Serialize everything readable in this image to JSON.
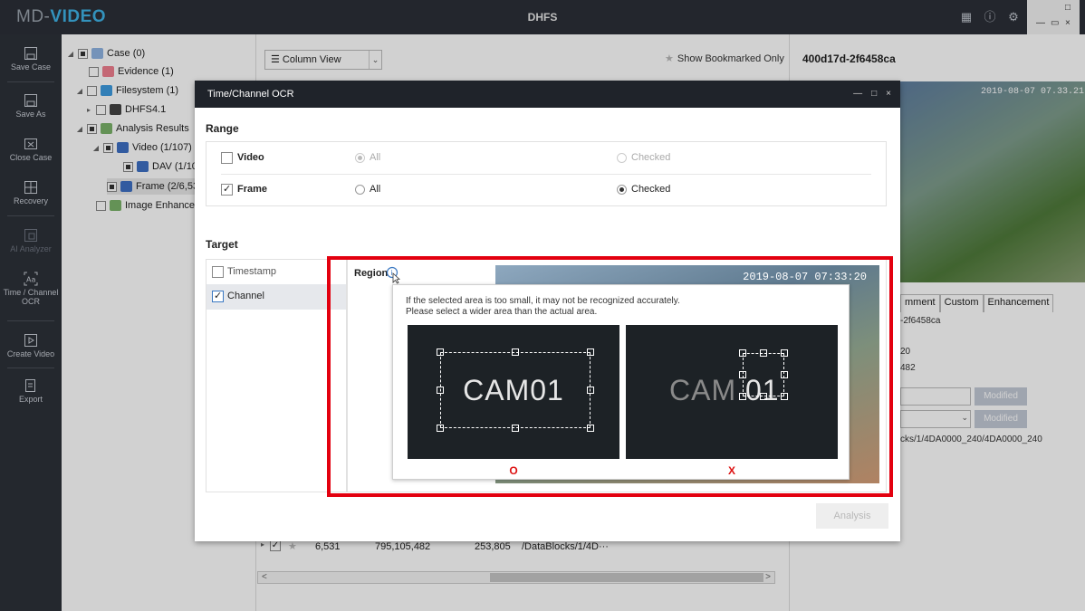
{
  "app": {
    "logo_main": "MD-",
    "logo_accent": "VIDEO",
    "title": "DHFS"
  },
  "sidebar": {
    "items": [
      {
        "label": "Save Case",
        "icon": "save-icon"
      },
      {
        "label": "Save As",
        "icon": "save-as-icon"
      },
      {
        "label": "Close Case",
        "icon": "close-case-icon"
      },
      {
        "label": "Recovery",
        "icon": "recovery-icon"
      },
      {
        "label": "AI Analyzer",
        "icon": "ai-analyzer-icon"
      },
      {
        "label": "Time / Channel OCR",
        "icon": "ocr-icon"
      },
      {
        "label": "Create Video",
        "icon": "create-video-icon"
      },
      {
        "label": "Export",
        "icon": "export-icon"
      }
    ]
  },
  "tree": {
    "items": [
      {
        "label": "Case (0)"
      },
      {
        "label": "Evidence (1)"
      },
      {
        "label": "Filesystem (1)"
      },
      {
        "label": "DHFS4.1"
      },
      {
        "label": "Analysis Results"
      },
      {
        "label": "Video (1/107)"
      },
      {
        "label": "DAV (1/10"
      },
      {
        "label": "Frame (2/6,53"
      },
      {
        "label": "Image Enhancem"
      }
    ]
  },
  "center": {
    "view_select": "Column View",
    "bookmark_label": "Show Bookmarked Only",
    "grid_row": {
      "col1": "6,531",
      "col2": "795,105,482",
      "col3": "253,805",
      "col4": "/DataBlocks/1/4D···"
    },
    "scroll_left": "<",
    "scroll_right": ">"
  },
  "right": {
    "title": "400d17d-2f6458ca",
    "image_timestamp": "2019-08-07 07.33.21",
    "tabs": [
      "mment",
      "Custom",
      "Enhancement"
    ],
    "lines": [
      "-2f6458ca",
      "20",
      "482"
    ],
    "modified_label": "Modified",
    "path": "cks/1/4DA0000_240/4DA0000_240"
  },
  "dialog": {
    "title": "Time/Channel OCR",
    "range_label": "Range",
    "target_label": "Target",
    "range_rows": [
      {
        "label": "Video",
        "checked": false,
        "all_label": "All",
        "checked_label": "Checked"
      },
      {
        "label": "Frame",
        "checked": true,
        "all_label": "All",
        "checked_label": "Checked"
      }
    ],
    "target_items": [
      {
        "label": "Timestamp",
        "checked": false
      },
      {
        "label": "Channel",
        "checked": true
      }
    ],
    "region_label": "Region",
    "preview_timestamp": "2019-08-07 07:33:20",
    "tooltip_line1": "If the selected area is too small, it may not be recognized accurately.",
    "tooltip_line2": "Please select a wider area than the actual area.",
    "example_text_left": "CAM01",
    "example_text_right_a": "CAM",
    "example_text_right_b": "01",
    "mark_good": "O",
    "mark_bad": "X",
    "analysis_button": "Analysis"
  },
  "colors": {
    "accent": "#3fb3e6",
    "highlight": "#e3000f",
    "dialog_header": "#1f232a",
    "sidebar": "#2d3139"
  }
}
